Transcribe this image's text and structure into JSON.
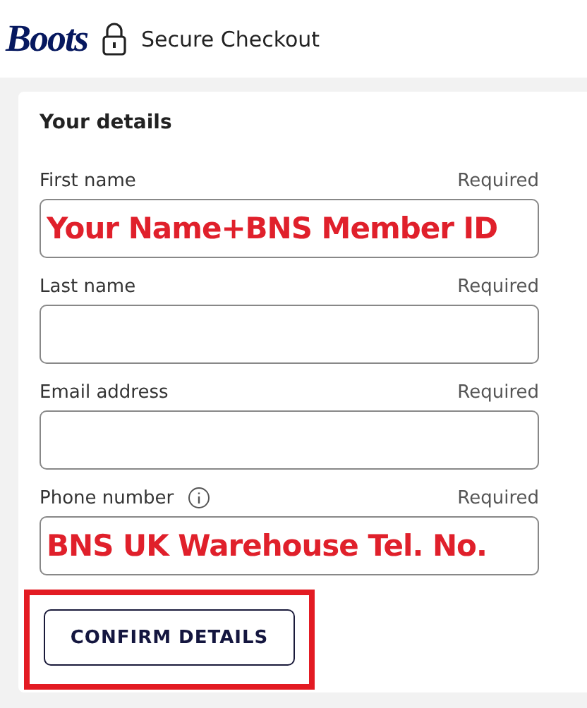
{
  "header": {
    "logo": "Boots",
    "title": "Secure Checkout"
  },
  "form": {
    "heading": "Your details",
    "fields": [
      {
        "label": "First name",
        "required": "Required",
        "value": "Your Name+BNS Member ID",
        "info": false
      },
      {
        "label": "Last name",
        "required": "Required",
        "info": false
      },
      {
        "label": "Email address",
        "required": "Required",
        "info": false
      },
      {
        "label": "Phone number",
        "required": "Required",
        "value": "BNS UK Warehouse Tel. No.",
        "info": true
      }
    ],
    "button": {
      "label": "CONFIRM DETAILS",
      "highlighted": true
    }
  }
}
